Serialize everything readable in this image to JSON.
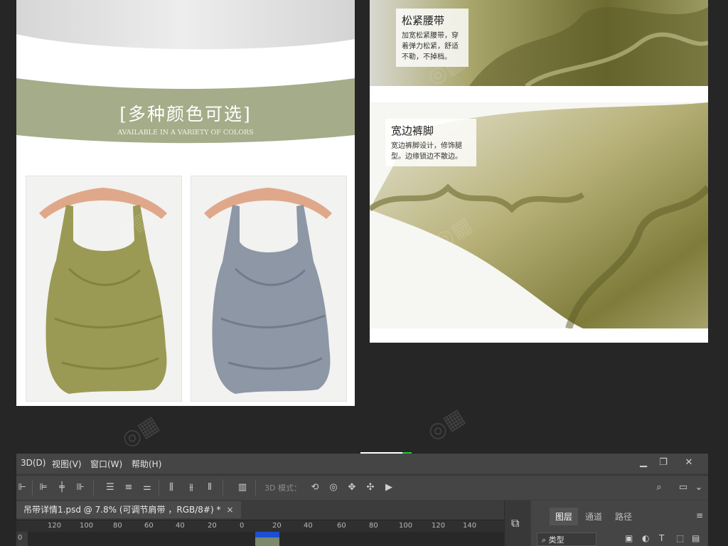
{
  "colors": {
    "sage": "#a4ac89",
    "olive": "#9a9a55",
    "blue_gray": "#8d97a6",
    "ps_bg": "#3c3c3c"
  },
  "left_panel": {
    "banner_title": "[多种颜色可选]",
    "banner_subtitle": "AVAILABLE IN A VARIETY OF COLORS",
    "products": [
      {
        "color_name": "olive"
      },
      {
        "color_name": "blue-gray"
      }
    ]
  },
  "right_panel": {
    "captions": [
      {
        "title": "松紧腰带",
        "body": "加宽松紧腰带，穿着弹力松紧，舒适不勒，不掉档。"
      },
      {
        "title": "宽边裤脚",
        "body": "宽边裤脚设计，修饰腿型。边缘锁边不散边。"
      }
    ]
  },
  "photoshop": {
    "menu": [
      "3D(D)",
      "视图(V)",
      "窗口(W)",
      "帮助(H)"
    ],
    "window_controls": [
      "minimize-icon",
      "restore-icon",
      "close-icon"
    ],
    "options_bar": {
      "mode_label": "3D 模式："
    },
    "document_tab": "吊带详情1.psd @ 7.8% (可调节肩带 ，RGB/8#) *",
    "document_close": "×",
    "ruler_ticks": [
      "120",
      "100",
      "80",
      "60",
      "40",
      "20",
      "0",
      "20",
      "40",
      "60",
      "80",
      "100",
      "120",
      "140"
    ],
    "vertical_ruler_tick": "0",
    "panel_tabs": [
      "图层",
      "通道",
      "路径"
    ],
    "active_panel_tab": "图层",
    "layer_filter": "类型"
  }
}
